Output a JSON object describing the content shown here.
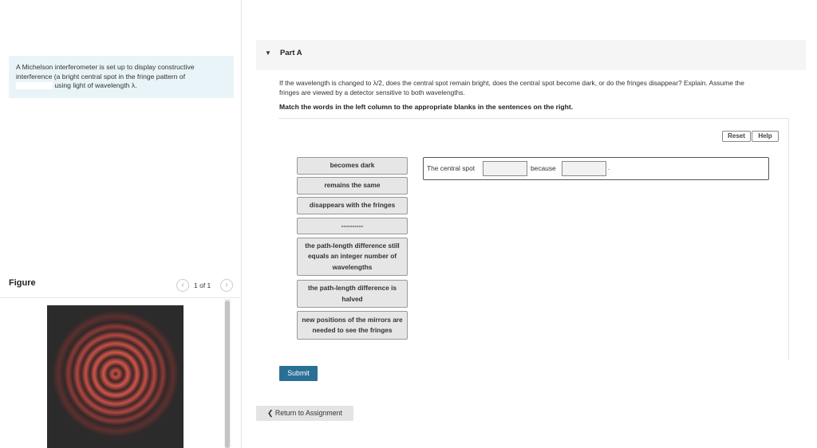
{
  "problem": {
    "text_line1": "A Michelson interferometer is set up to display constructive",
    "text_line2": "interference (a bright central spot in the fringe pattern of",
    "text_line3": "using light of wavelength λ."
  },
  "figure": {
    "title": "Figure",
    "pager": "1 of 1"
  },
  "part": {
    "title": "Part A",
    "question_line1": "If the wavelength is changed to λ/2, does the central spot remain bright, does the central spot become dark, or do the fringes disappear? Explain. Assume the",
    "question_line2": "fringes are viewed by a detector sensitive to both wavelengths.",
    "instruction": "Match the words in the left column to the appropriate blanks in the sentences on the right."
  },
  "controls": {
    "reset_label": "Reset",
    "help_label": "Help",
    "submit_label": "Submit",
    "return_label": "Return to Assignment"
  },
  "tiles": [
    "becomes dark",
    "remains the same",
    "disappears with the fringes",
    "----------",
    "the path-length difference still equals an integer number of wavelengths",
    "the path-length difference is halved",
    "new positions of the mirrors are needed to see the fringes"
  ],
  "sentence": {
    "start": "The central spot",
    "middle": "because",
    "end": "."
  },
  "colors": {
    "accent": "#2a6f96",
    "problem_bg": "#e9f4f9",
    "fringe": "#d2564a"
  }
}
